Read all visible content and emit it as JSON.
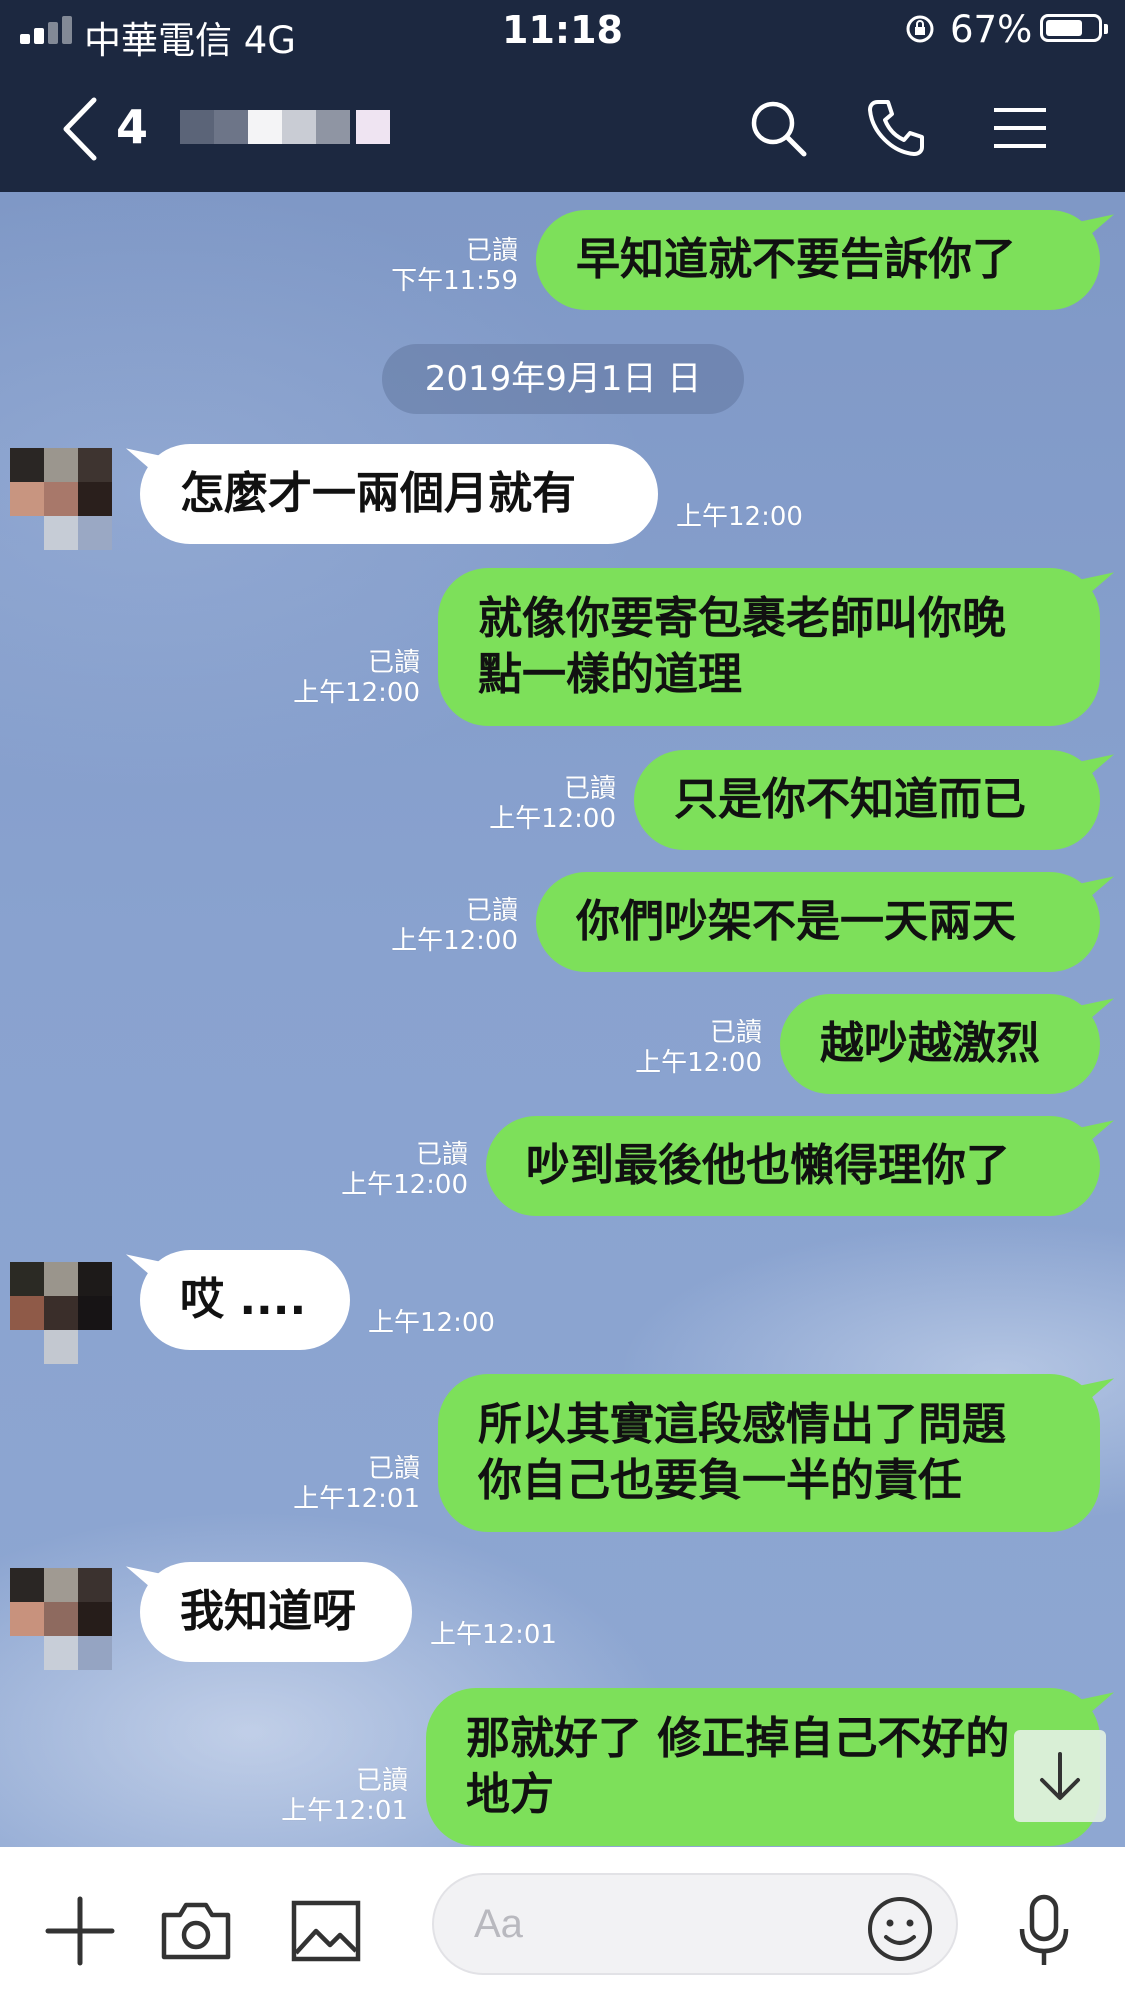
{
  "status_bar": {
    "carrier": "中華電信  4G",
    "time": "11:18",
    "battery": "67%",
    "battery_level": 0.67,
    "icons": [
      "signal-icon",
      "orientation-lock-icon",
      "battery-icon"
    ]
  },
  "header": {
    "unread_count": "4",
    "contact_name_censored": true,
    "icons": [
      "back-icon",
      "search-icon",
      "phone-icon",
      "menu-icon"
    ]
  },
  "date_separator": "2019年9月1日 日",
  "messages": [
    {
      "side": "out",
      "text": "早知道就不要告訴你了",
      "read": "已讀",
      "time": "下午11:59"
    },
    {
      "side": "in",
      "text": "怎麼才一兩個月就有",
      "time": "上午12:00"
    },
    {
      "side": "out",
      "text": "就像你要寄包裹老師叫你晚\n點一樣的道理",
      "read": "已讀",
      "time": "上午12:00"
    },
    {
      "side": "out",
      "text": "只是你不知道而已",
      "read": "已讀",
      "time": "上午12:00"
    },
    {
      "side": "out",
      "text": "你們吵架不是一天兩天",
      "read": "已讀",
      "time": "上午12:00"
    },
    {
      "side": "out",
      "text": "越吵越激烈",
      "read": "已讀",
      "time": "上午12:00"
    },
    {
      "side": "out",
      "text": "吵到最後他也懶得理你了",
      "read": "已讀",
      "time": "上午12:00"
    },
    {
      "side": "in",
      "text": "哎 ....",
      "time": "上午12:00"
    },
    {
      "side": "out",
      "text": "所以其實這段感情出了問題\n你自己也要負一半的責任",
      "read": "已讀",
      "time": "上午12:01"
    },
    {
      "side": "in",
      "text": "我知道呀",
      "time": "上午12:01"
    },
    {
      "side": "out",
      "text": "那就好了 修正掉自己不好的\n地方",
      "read": "已讀",
      "time": "上午12:01"
    }
  ],
  "input": {
    "placeholder": "Aa"
  },
  "bottom_icons": [
    "plus-icon",
    "camera-icon",
    "image-icon",
    "emoji-icon",
    "microphone-icon",
    "scroll-down-icon"
  ],
  "colors": {
    "header": "#1c2840",
    "outgoing_bubble": "#7de05a",
    "incoming_bubble": "#ffffff"
  }
}
